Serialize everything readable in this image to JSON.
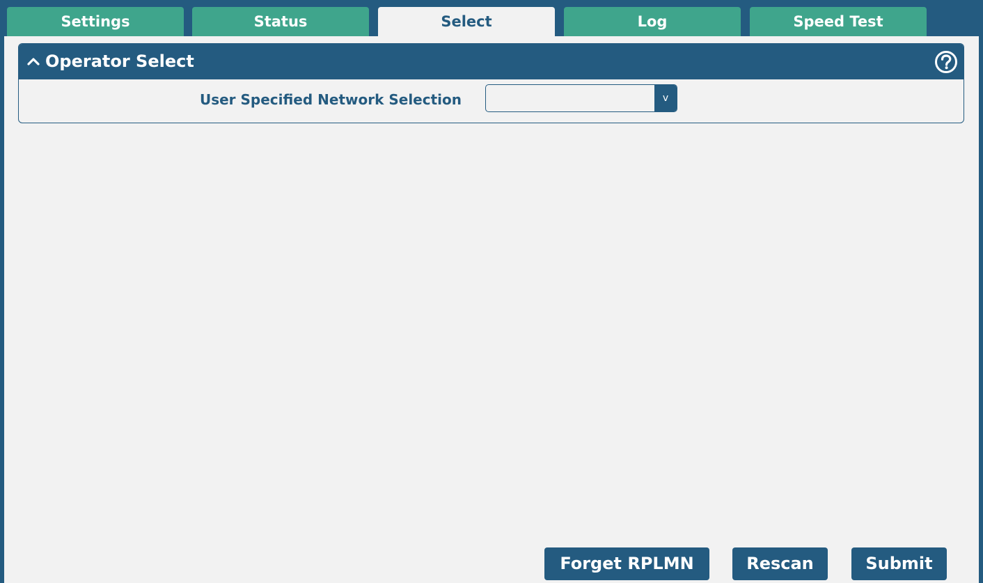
{
  "tabs": [
    {
      "label": "Settings",
      "active": false
    },
    {
      "label": "Status",
      "active": false
    },
    {
      "label": "Select",
      "active": true
    },
    {
      "label": "Log",
      "active": false
    },
    {
      "label": "Speed Test",
      "active": false
    }
  ],
  "section": {
    "title": "Operator Select",
    "collapse_icon": "chevron-up-icon",
    "help_icon": "question-circle-icon"
  },
  "form": {
    "network_selection_label": "User Specified Network Selection",
    "network_selection_value": "",
    "dropdown_arrow": "v"
  },
  "buttons": {
    "forget_rplmn": "Forget RPLMN",
    "rescan": "Rescan",
    "submit": "Submit"
  },
  "colors": {
    "primary": "#245b80",
    "tab_inactive": "#3fa58c",
    "background": "#f2f2f2",
    "text_on_dark": "#ffffff"
  }
}
